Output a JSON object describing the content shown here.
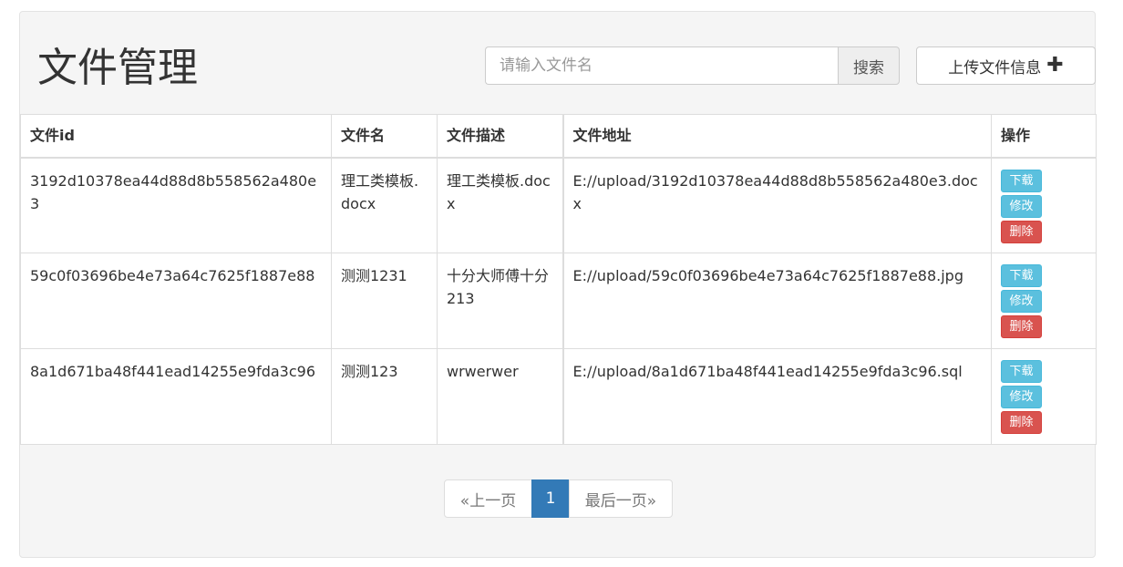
{
  "header": {
    "title": "文件管理",
    "search_placeholder": "请输入文件名",
    "search_value": "",
    "search_button": "搜索",
    "upload_button": "上传文件信息"
  },
  "table": {
    "columns": [
      "文件id",
      "文件名",
      "文件描述",
      "文件地址",
      "操作"
    ],
    "rows": [
      {
        "id": "3192d10378ea44d88d8b558562a480e3",
        "name": "理工类模板.docx",
        "desc": "理工类模板.docx",
        "url": "E://upload/3192d10378ea44d88d8b558562a480e3.docx"
      },
      {
        "id": "59c0f03696be4e73a64c7625f1887e88",
        "name": "测测1231",
        "desc": "十分大师傅十分213",
        "url": "E://upload/59c0f03696be4e73a64c7625f1887e88.jpg"
      },
      {
        "id": "8a1d671ba48f441ead14255e9fda3c96",
        "name": "测测123",
        "desc": "wrwerwer",
        "url": "E://upload/8a1d671ba48f441ead14255e9fda3c96.sql"
      }
    ],
    "actions": {
      "download": "下载",
      "edit": "修改",
      "delete": "删除"
    }
  },
  "pagination": {
    "prev": "«上一页",
    "current": "1",
    "next": "最后一页»"
  },
  "colors": {
    "info": "#5bc0de",
    "danger": "#d9534f",
    "primary": "#337ab7"
  },
  "icons": {
    "upload": "plus-icon"
  }
}
